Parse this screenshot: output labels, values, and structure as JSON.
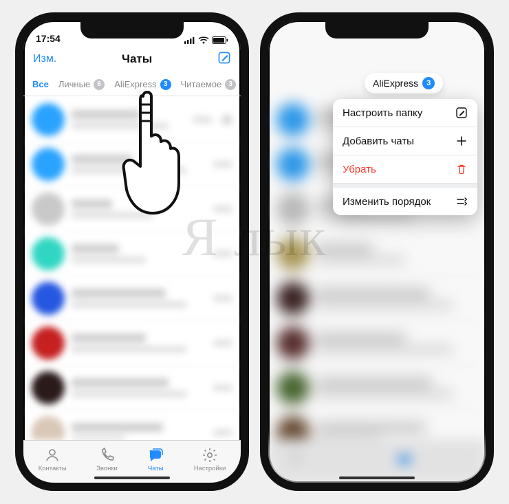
{
  "status": {
    "time": "17:54"
  },
  "nav": {
    "edit": "Изм.",
    "title": "Чаты"
  },
  "filters": {
    "all": "Все",
    "personal": {
      "label": "Личные",
      "count": "6"
    },
    "ali": {
      "label": "AliExpress",
      "count": "3"
    },
    "readable": {
      "label": "Читаемое",
      "count": "3"
    }
  },
  "bottom_tabs": {
    "contacts": "Контакты",
    "calls": "Звонки",
    "chats": "Чаты",
    "settings": "Настройки"
  },
  "chip": {
    "label": "AliExpress",
    "count": "3"
  },
  "menu": {
    "configure": "Настроить папку",
    "add": "Добавить чаты",
    "remove": "Убрать",
    "reorder": "Изменить порядок"
  },
  "watermark": "Я     лык"
}
